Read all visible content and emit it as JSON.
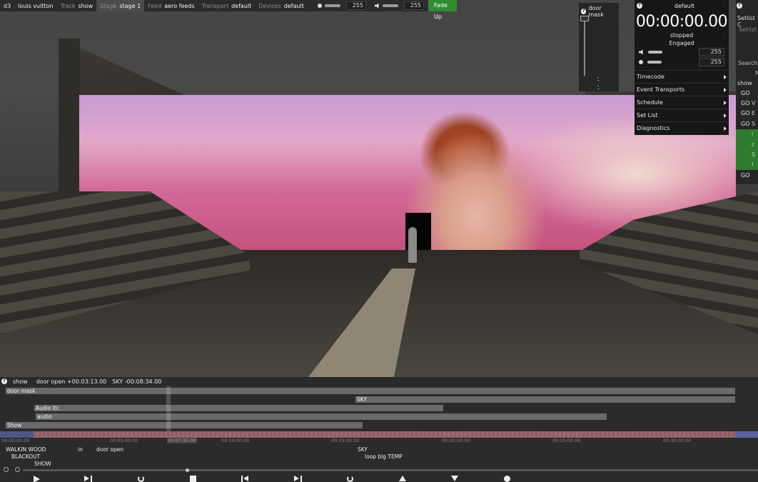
{
  "topbar": {
    "app": "d3",
    "project": "louis vuitton",
    "track_label": "Track",
    "track_value": "show",
    "stage_label": "Stage",
    "stage_value": "stage 1",
    "feed_label": "Feed",
    "feed_value": "aero feeds",
    "transport_label": "Transport",
    "transport_value": "default",
    "devices_label": "Devices",
    "devices_value": "default",
    "brightness_value": "255",
    "volume_value": "255",
    "fade_button": "Fade Up",
    "fade_color": "#2f8d2f"
  },
  "doormask": {
    "title": "door mask",
    "ticks": [
      "-",
      "-"
    ]
  },
  "transport": {
    "title": "default",
    "timecode": "00:00:00.00",
    "state": "stopped",
    "mode": "Engaged",
    "volume_value": "255",
    "brightness_value": "255",
    "menu": [
      "Timecode",
      "Event Transports",
      "Schedule",
      "Set List",
      "Diagnostics"
    ]
  },
  "setlist": {
    "tab1": "Setlist C",
    "tab2": "Setlist",
    "search": "Search",
    "col_n": "N",
    "header": "show",
    "rows": [
      {
        "go": "GO",
        "text": "V",
        "green": false
      },
      {
        "go": "GO",
        "text": "E",
        "green": false
      },
      {
        "go": "GO",
        "text": "S",
        "green": false
      },
      {
        "go": "",
        "text": "i",
        "green": true
      },
      {
        "go": "",
        "text": "c",
        "green": true
      },
      {
        "go": "",
        "text": "S",
        "green": true
      },
      {
        "go": "",
        "text": "I",
        "green": true
      },
      {
        "go": "GO",
        "text": "",
        "green": false
      }
    ],
    "first_go": "GO"
  },
  "timeline": {
    "track": "show",
    "cue_current": "door open +00:03:13.00",
    "cue_next": "SKY -00:08:34.00",
    "layers": [
      {
        "label": "door mask"
      },
      {
        "label": "SKY"
      },
      {
        "label": "Audio  ltc"
      },
      {
        "label": "audio"
      },
      {
        "label": "Show"
      }
    ],
    "ruler": [
      "00:00:00.00",
      "00:05:00.00",
      "00:07:35.00",
      "00:10:00.00",
      "00:15:00.00",
      "00:20:00.00",
      "00:25:00.00",
      "00:30:00.00"
    ],
    "cues": [
      "WALKIN WOOD",
      "in",
      "door open",
      "SKY",
      "BLACKOUT",
      "loop blg TEMP",
      "SHOW"
    ]
  }
}
